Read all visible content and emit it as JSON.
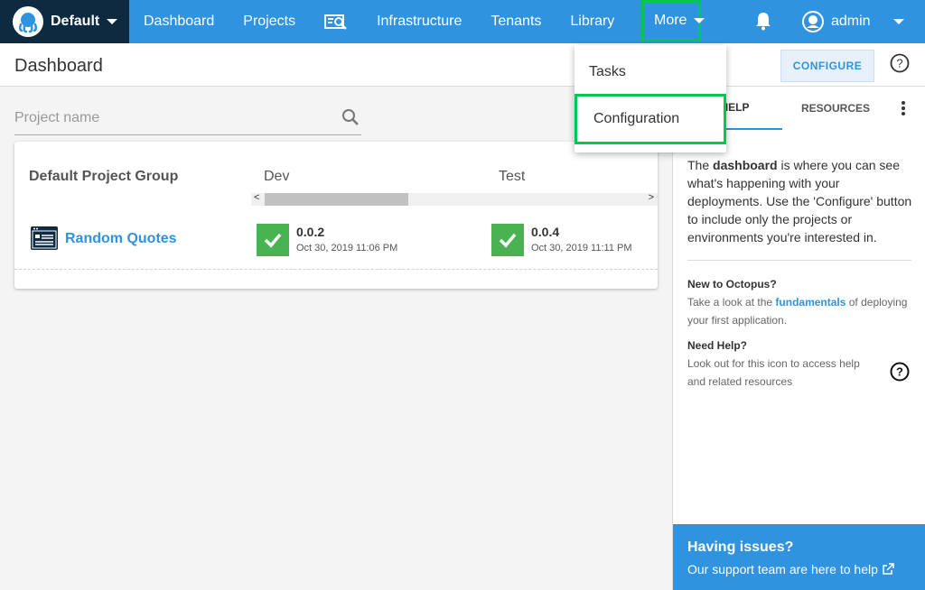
{
  "topbar": {
    "space_name": "Default",
    "nav": [
      "Dashboard",
      "Projects",
      "Infrastructure",
      "Tenants",
      "Library"
    ],
    "more_label": "More",
    "user_name": "admin"
  },
  "pagebar": {
    "title": "Dashboard",
    "configure_label": "CONFIGURE"
  },
  "search": {
    "placeholder": "Project name"
  },
  "dashboard": {
    "group_name": "Default Project Group",
    "environments": [
      "Dev",
      "Test"
    ],
    "project": {
      "name": "Random Quotes",
      "releases": [
        {
          "version": "0.0.2",
          "date": "Oct 30, 2019 11:06 PM"
        },
        {
          "version": "0.0.4",
          "date": "Oct 30, 2019 11:11 PM"
        }
      ]
    }
  },
  "dropdown": {
    "items": [
      "Tasks",
      "Configuration"
    ]
  },
  "sidebar": {
    "tabs": [
      "HELP",
      "RESOURCES"
    ],
    "intro_pre": "The ",
    "intro_bold": "dashboard",
    "intro_post": " is where you can see what's happening with your deployments. Use the 'Configure' button to include only the projects or environments you're interested in.",
    "new_heading": "New to Octopus?",
    "new_pre": "Take a look at the ",
    "new_link": "fundamentals",
    "new_post": " of deploying your first application.",
    "need_heading": "Need Help?",
    "need_text": "Look out for this icon to access help and related resources",
    "issues_title": "Having issues?",
    "issues_link": "Our support team are here to help"
  },
  "colors": {
    "nav_blue": "#2f93e0",
    "space_dark": "#0d2a40",
    "success_green": "#48b350",
    "highlight_green": "#00c853"
  }
}
